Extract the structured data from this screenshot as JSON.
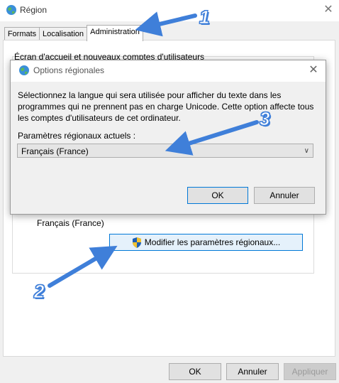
{
  "main_window": {
    "title": "Région",
    "close_glyph": "✕",
    "tabs": [
      {
        "label": "Formats"
      },
      {
        "label": "Localisation"
      },
      {
        "label": "Administration"
      }
    ],
    "panel_heading": "Écran d'accueil et nouveaux comptes d'utilisateurs",
    "current_locale": "Français (France)",
    "change_locale_label": "Modifier les paramètres régionaux...",
    "buttons": {
      "ok": "OK",
      "cancel": "Annuler",
      "apply": "Appliquer"
    }
  },
  "dialog": {
    "title": "Options régionales",
    "close_glyph": "✕",
    "description": "Sélectionnez la langue qui sera utilisée pour afficher du texte dans les programmes qui ne prennent pas en charge Unicode. Cette option affecte tous les comptes d'utilisateurs de cet ordinateur.",
    "locale_label": "Paramètres régionaux actuels :",
    "locale_value": "Français (France)",
    "buttons": {
      "ok": "OK",
      "cancel": "Annuler"
    }
  },
  "annotations": {
    "one": "1",
    "two": "2",
    "three": "3"
  },
  "colors": {
    "accent": "#0078d7",
    "arrow": "#3f7fd9"
  },
  "icons": {
    "app": "globe-icon",
    "admin": "uac-shield-icon",
    "select": "chevron-down-icon"
  }
}
